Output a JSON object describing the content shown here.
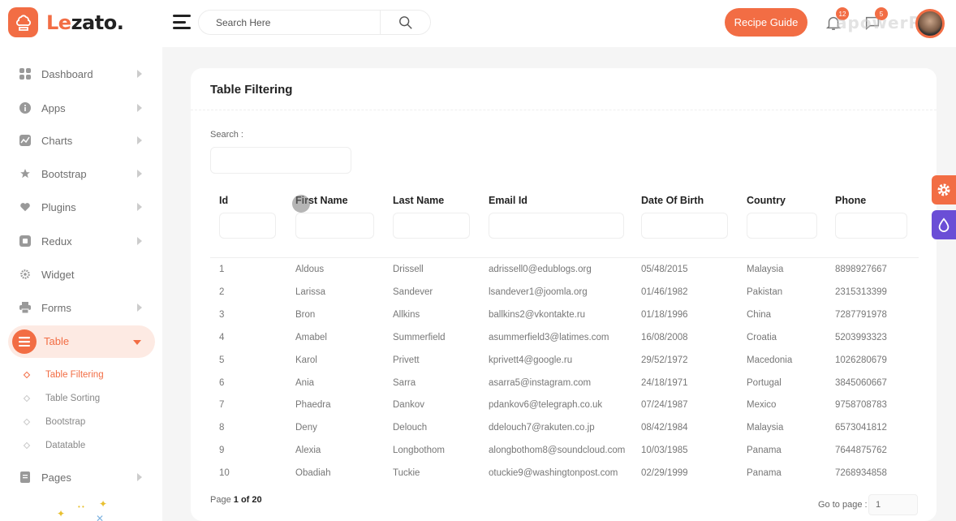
{
  "brand": {
    "name_first": "Le",
    "name_rest": "zato.",
    "accent": "#f26d44"
  },
  "header": {
    "search_placeholder": "Search Here",
    "recipe_button": "Recipe Guide",
    "notifications_count": "12",
    "messages_count": "5",
    "watermark": "apowerR"
  },
  "sidebar": {
    "items": [
      {
        "label": "Dashboard",
        "icon": "grid-icon"
      },
      {
        "label": "Apps",
        "icon": "info-icon"
      },
      {
        "label": "Charts",
        "icon": "chart-icon"
      },
      {
        "label": "Bootstrap",
        "icon": "star-icon"
      },
      {
        "label": "Plugins",
        "icon": "heart-icon"
      },
      {
        "label": "Redux",
        "icon": "square-icon"
      },
      {
        "label": "Widget",
        "icon": "gear-icon"
      },
      {
        "label": "Forms",
        "icon": "printer-icon"
      },
      {
        "label": "Table",
        "icon": "list-icon"
      },
      {
        "label": "Pages",
        "icon": "document-icon"
      }
    ],
    "table_submenu": [
      "Table Filtering",
      "Table Sorting",
      "Bootstrap",
      "Datatable"
    ]
  },
  "card": {
    "title": "Table Filtering",
    "search_label": "Search :",
    "columns": [
      "Id",
      "First Name",
      "Last Name",
      "Email Id",
      "Date Of Birth",
      "Country",
      "Phone"
    ],
    "rows": [
      [
        "1",
        "Aldous",
        "Drissell",
        "adrissell0@edublogs.org",
        "05/48/2015",
        "Malaysia",
        "8898927667"
      ],
      [
        "2",
        "Larissa",
        "Sandever",
        "lsandever1@joomla.org",
        "01/46/1982",
        "Pakistan",
        "2315313399"
      ],
      [
        "3",
        "Bron",
        "Allkins",
        "ballkins2@vkontakte.ru",
        "01/18/1996",
        "China",
        "7287791978"
      ],
      [
        "4",
        "Amabel",
        "Summerfield",
        "asummerfield3@latimes.com",
        "16/08/2008",
        "Croatia",
        "5203993323"
      ],
      [
        "5",
        "Karol",
        "Privett",
        "kprivett4@google.ru",
        "29/52/1972",
        "Macedonia",
        "1026280679"
      ],
      [
        "6",
        "Ania",
        "Sarra",
        "asarra5@instagram.com",
        "24/18/1971",
        "Portugal",
        "3845060667"
      ],
      [
        "7",
        "Phaedra",
        "Dankov",
        "pdankov6@telegraph.co.uk",
        "07/24/1987",
        "Mexico",
        "9758708783"
      ],
      [
        "8",
        "Deny",
        "Delouch",
        "ddelouch7@rakuten.co.jp",
        "08/42/1984",
        "Malaysia",
        "6573041812"
      ],
      [
        "9",
        "Alexia",
        "Longbothom",
        "alongbothom8@soundcloud.com",
        "10/03/1985",
        "Panama",
        "7644875762"
      ],
      [
        "10",
        "Obadiah",
        "Tuckie",
        "otuckie9@washingtonpost.com",
        "02/29/1999",
        "Panama",
        "7268934858"
      ]
    ],
    "page_prefix": "Page",
    "page_current": "1 of 20",
    "goto_label": "Go to page :",
    "goto_value": "1"
  }
}
